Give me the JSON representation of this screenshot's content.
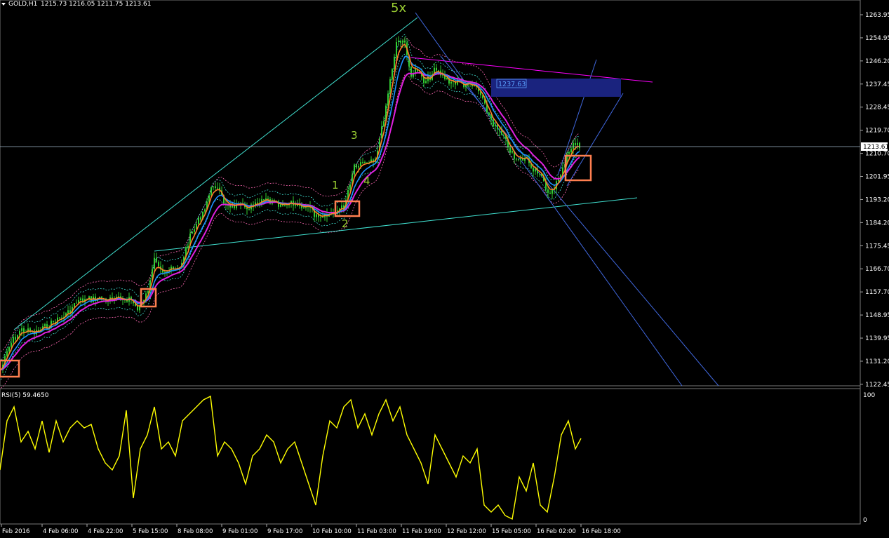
{
  "header": {
    "title": "GOLD,H1",
    "ohlc": "1215.73 1216.05 1211.75 1213.61"
  },
  "price_axis": {
    "labels": [
      "1263.95",
      "1254.95",
      "1246.20",
      "1237.45",
      "1228.45",
      "1219.70",
      "1210.70",
      "1201.95",
      "1193.20",
      "1184.20",
      "1175.45",
      "1166.70",
      "1157.70",
      "1148.95",
      "1139.95",
      "1131.20",
      "1122.45"
    ],
    "current_price": "1213.61"
  },
  "time_axis": {
    "labels": [
      "Feb 2016",
      "4 Feb 06:00",
      "4 Feb 22:00",
      "5 Feb 15:00",
      "8 Feb 08:00",
      "9 Feb 01:00",
      "9 Feb 17:00",
      "10 Feb 10:00",
      "11 Feb 03:00",
      "11 Feb 19:00",
      "12 Feb 12:00",
      "15 Feb 05:00",
      "16 Feb 02:00",
      "16 Feb 18:00"
    ]
  },
  "annotations": {
    "waves": [
      "1",
      "2",
      "3",
      "4",
      "5x"
    ],
    "target_label": "1237.63"
  },
  "rsi": {
    "title": "RSI(5) 59.4650",
    "max_label": "100",
    "min_label": "0"
  },
  "colors": {
    "background": "#000000",
    "candle": "#32cd32",
    "ema_fast": "#ff7f27",
    "ema_mid": "#1e90ff",
    "ema_slow": "#e020e0",
    "rsi_line": "#ffff00",
    "wave_label": "#9acd32",
    "box": "#ff7f50",
    "target_zone": "#1a237e",
    "trend_cyan": "#40e0d0",
    "channel_blue": "#4169e1",
    "magenta_line": "#ff00ff"
  }
}
